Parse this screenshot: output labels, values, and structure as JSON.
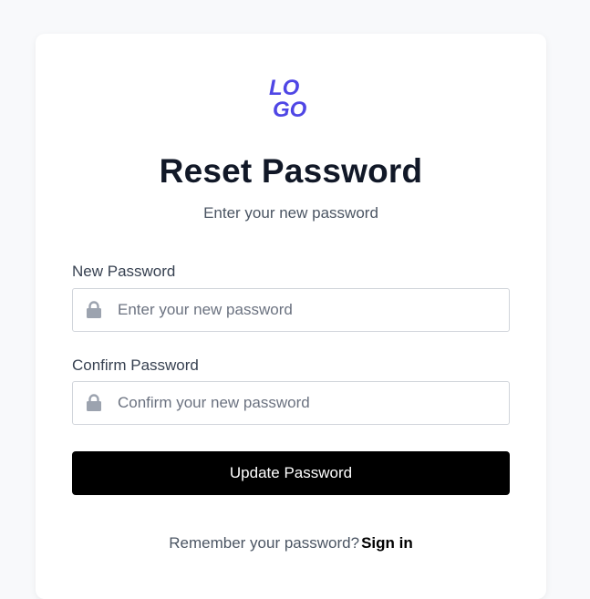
{
  "brand": {
    "logo_text": "LOGO",
    "logo_color": "#4f46e5"
  },
  "header": {
    "title": "Reset Password",
    "subtitle": "Enter your new password"
  },
  "form": {
    "new_password": {
      "label": "New Password",
      "placeholder": "Enter your new password",
      "value": "",
      "icon": "lock-icon"
    },
    "confirm_password": {
      "label": "Confirm Password",
      "placeholder": "Confirm your new password",
      "value": "",
      "icon": "lock-icon"
    },
    "submit_label": "Update Password"
  },
  "footer": {
    "prompt": "Remember your password?",
    "link_label": "Sign in"
  },
  "colors": {
    "page_background": "#f8f9fb",
    "card_background": "#ffffff",
    "primary_button": "#000000",
    "icon": "#9ca3af"
  }
}
